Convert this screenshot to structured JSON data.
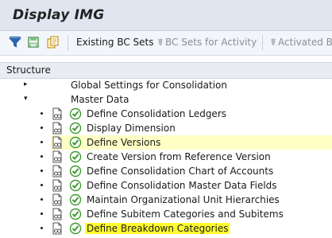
{
  "window": {
    "title": "Display IMG"
  },
  "toolbar": {
    "icons": [
      "filter-icon",
      "save-variant-icon",
      "copy-icon"
    ],
    "buttons": [
      {
        "label": "Existing BC Sets",
        "enabled": true,
        "icon": ""
      },
      {
        "label": "BC Sets for Activity",
        "enabled": false,
        "icon": "bc-set-icon"
      },
      {
        "label": "Activated B",
        "enabled": false,
        "icon": "bc-set-icon"
      }
    ]
  },
  "structure": {
    "header": "Structure",
    "items": [
      {
        "label": "Global Settings for Consolidation",
        "level": 1,
        "type": "node",
        "expander": "▸"
      },
      {
        "label": "Master Data",
        "level": 1,
        "type": "node",
        "expander": "▾"
      },
      {
        "label": "Define Consolidation Ledgers",
        "level": 2,
        "type": "activity"
      },
      {
        "label": "Display Dimension",
        "level": 2,
        "type": "activity"
      },
      {
        "label": "Define Versions",
        "level": 2,
        "type": "activity",
        "highlight": "row"
      },
      {
        "label": "Create Version from Reference Version",
        "level": 2,
        "type": "activity"
      },
      {
        "label": "Define Consolidation Chart of Accounts",
        "level": 2,
        "type": "activity"
      },
      {
        "label": "Define Consolidation Master Data Fields",
        "level": 2,
        "type": "activity"
      },
      {
        "label": "Maintain Organizational Unit Hierarchies",
        "level": 2,
        "type": "activity"
      },
      {
        "label": "Define Subitem Categories and Subitems",
        "level": 2,
        "type": "activity"
      },
      {
        "label": "Define Breakdown Categories",
        "level": 2,
        "type": "activity",
        "highlight": "text"
      }
    ]
  },
  "colors": {
    "row_highlight": "#ffffc6",
    "text_highlight": "#fffc2e",
    "exec_green": "#3e9b2f"
  }
}
